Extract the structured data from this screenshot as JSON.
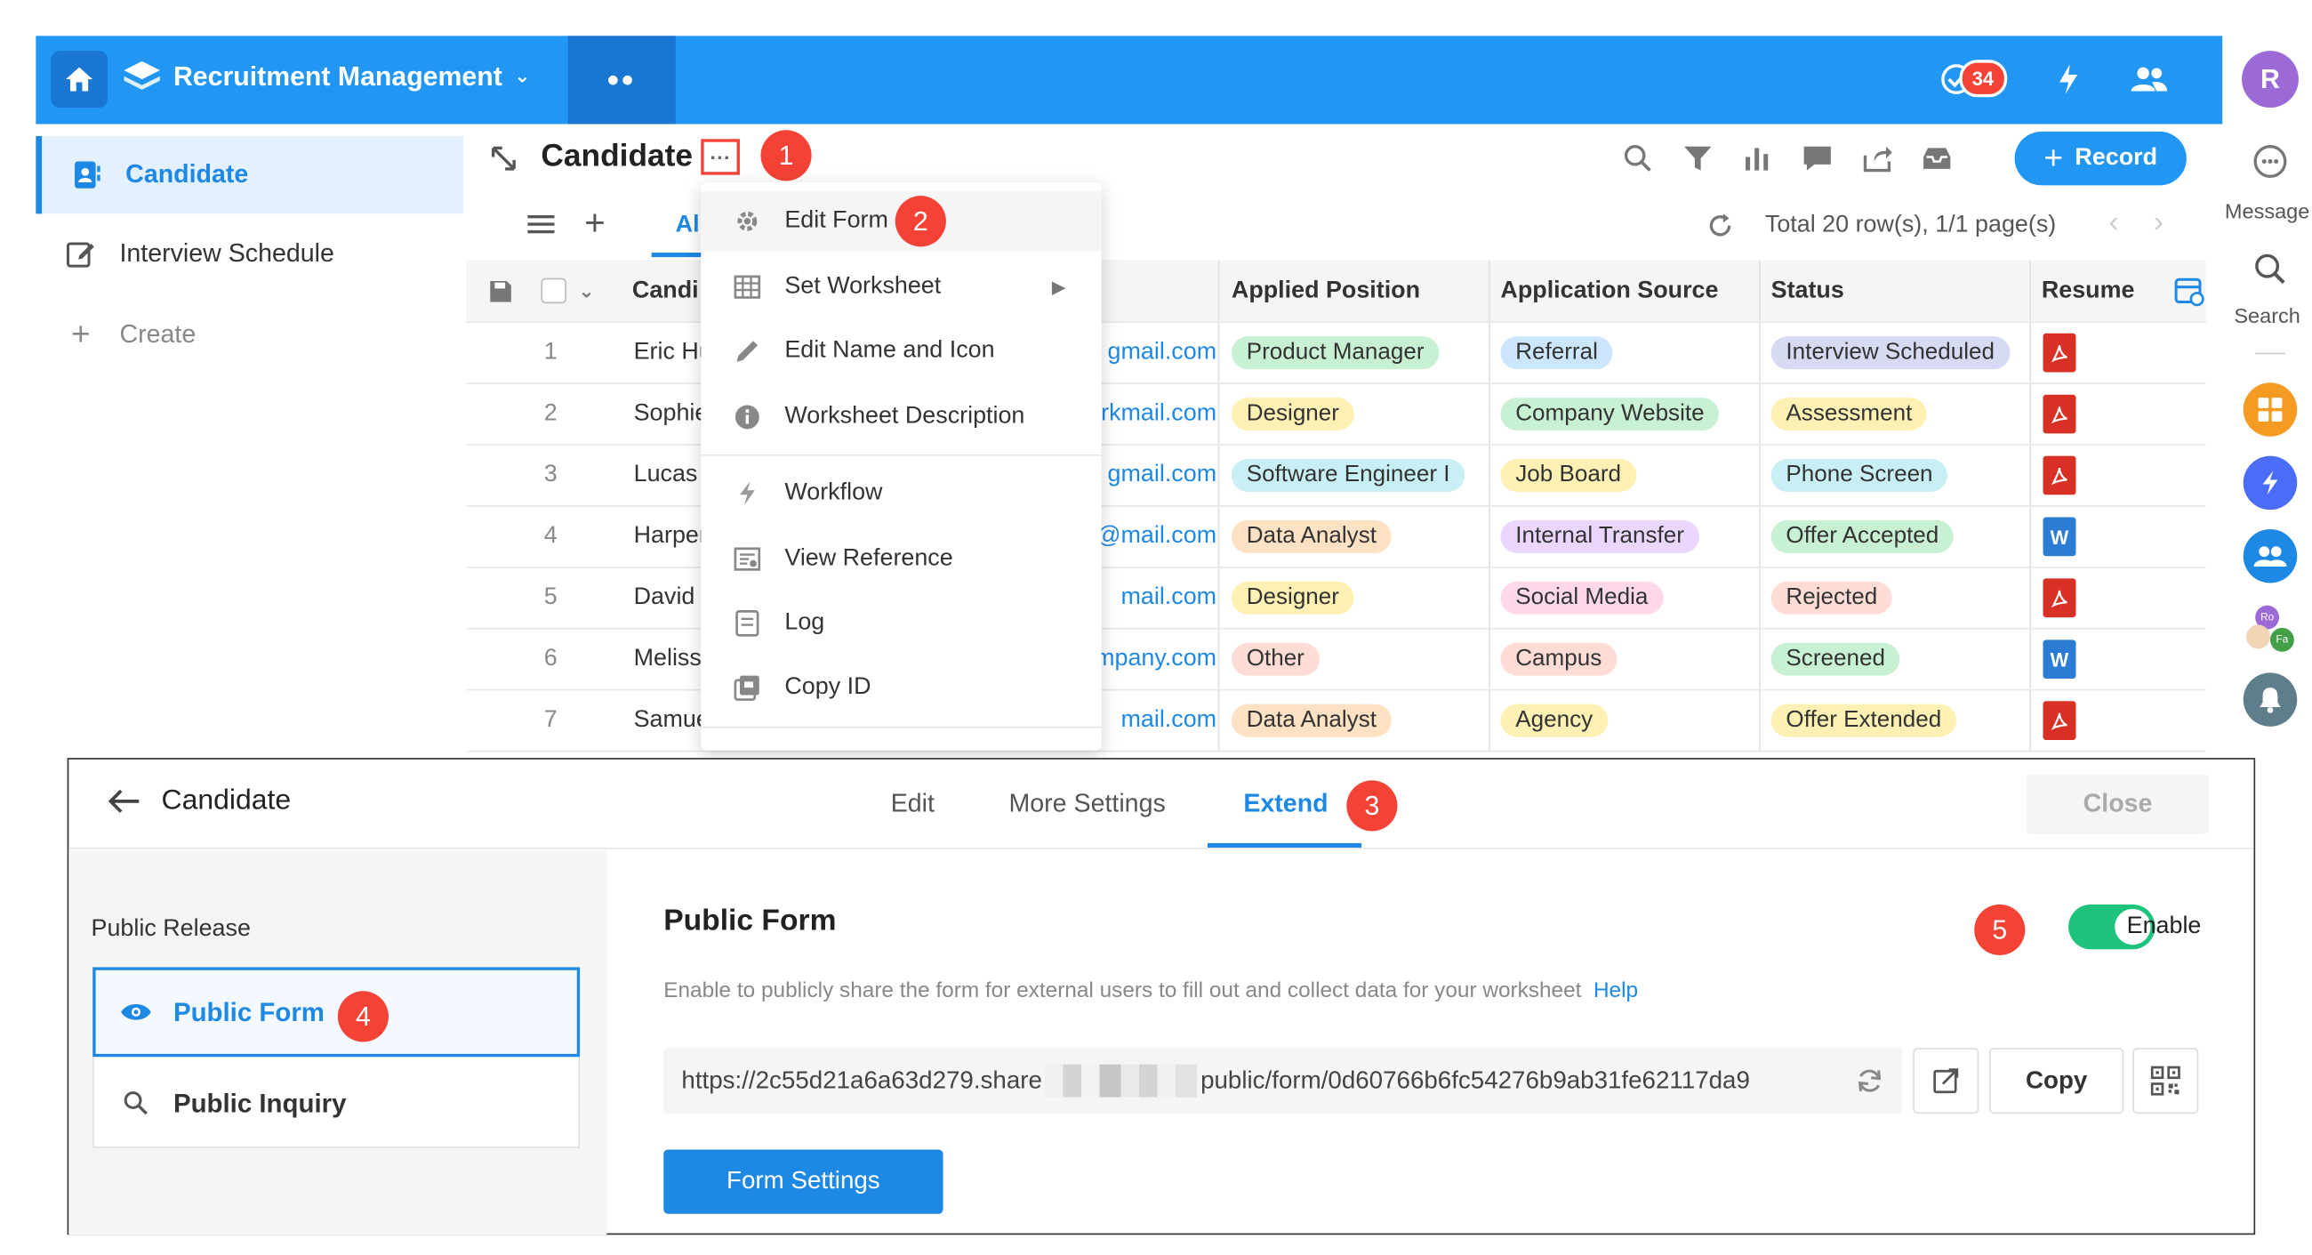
{
  "app": {
    "title": "Recruitment Management",
    "notification_count": "34",
    "user_initial": "R"
  },
  "rail": {
    "message_label": "Message",
    "search_label": "Search",
    "mini_avatar_1": "Ro",
    "mini_avatar_2": "Fa"
  },
  "nav": {
    "items": [
      {
        "label": "Candidate"
      },
      {
        "label": "Interview Schedule"
      },
      {
        "label": "Create"
      }
    ]
  },
  "worksheet": {
    "title": "Candidate",
    "more": "···",
    "record_button": "Record",
    "view_tab": "All",
    "pagination": "Total 20 row(s), 1/1 page(s)"
  },
  "steps": [
    "1",
    "2",
    "3",
    "4",
    "5"
  ],
  "table": {
    "headers": {
      "name": "Candi",
      "applied_position": "Applied Position",
      "application_source": "Application Source",
      "status": "Status",
      "resume": "Resume"
    },
    "rows": [
      {
        "num": "1",
        "name": "Eric Hu",
        "email": "gmail.com",
        "position": "Product Manager",
        "source": "Referral",
        "status": "Interview Scheduled",
        "resume": "pdf"
      },
      {
        "num": "2",
        "name": "Sophie",
        "email": "vorkmail.com",
        "position": "Designer",
        "source": "Company Website",
        "status": "Assessment",
        "resume": "pdf"
      },
      {
        "num": "3",
        "name": "Lucas",
        "email": "gmail.com",
        "position": "Software Engineer I",
        "source": "Job Board",
        "status": "Phone Screen",
        "resume": "pdf"
      },
      {
        "num": "4",
        "name": "Harper",
        "email": "@mail.com",
        "position": "Data Analyst",
        "source": "Internal Transfer",
        "status": "Offer Accepted",
        "resume": "W"
      },
      {
        "num": "5",
        "name": "David",
        "email": "mail.com",
        "position": "Designer",
        "source": "Social Media",
        "status": "Rejected",
        "resume": "pdf"
      },
      {
        "num": "6",
        "name": "Meliss",
        "email": "mpany.com",
        "position": "Other",
        "source": "Campus",
        "status": "Screened",
        "resume": "W"
      },
      {
        "num": "7",
        "name": "Samue",
        "email": "mail.com",
        "position": "Data Analyst",
        "source": "Agency",
        "status": "Offer Extended",
        "resume": "pdf"
      }
    ]
  },
  "menu": {
    "items": [
      {
        "label": "Edit Form"
      },
      {
        "label": "Set Worksheet"
      },
      {
        "label": "Edit Name and Icon"
      },
      {
        "label": "Worksheet Description"
      },
      {
        "label": "Workflow"
      },
      {
        "label": "View Reference"
      },
      {
        "label": "Log"
      },
      {
        "label": "Copy ID"
      }
    ]
  },
  "panel": {
    "back_title": "Candidate",
    "tabs": [
      "Edit",
      "More Settings",
      "Extend"
    ],
    "active_tab": "Extend",
    "close": "Close",
    "sidebar_title": "Public Release",
    "sidebar_items": [
      "Public Form",
      "Public Inquiry"
    ],
    "section_title": "Public Form",
    "enable_label": "Enable",
    "enabled": true,
    "description": "Enable to publicly share the form for external users to fill out and collect data for your worksheet",
    "help": "Help",
    "url_prefix": "https://2c55d21a6a63d279.share",
    "url_suffix": "public/form/0d60766b6fc54276b9ab31fe62117da9",
    "copy": "Copy",
    "form_settings": "Form Settings"
  },
  "colors": {
    "accent": "#2196f3",
    "step_badge": "#f44336",
    "toggle_on": "#1ec37c"
  }
}
